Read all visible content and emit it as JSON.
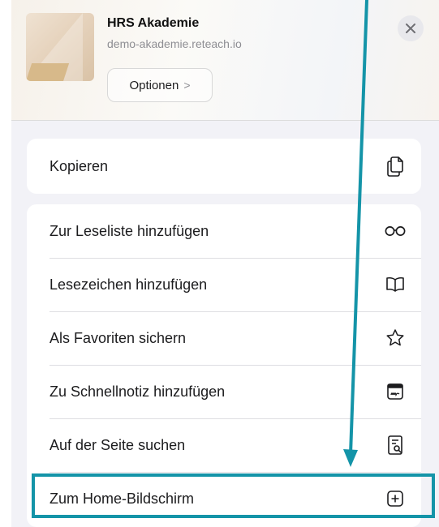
{
  "header": {
    "title": "HRS Akademie",
    "url": "demo-akademie.reteach.io",
    "options_label": "Optionen",
    "options_chevron": ">"
  },
  "menu": {
    "group1": [
      {
        "label": "Kopieren",
        "icon": "copy-icon"
      }
    ],
    "group2": [
      {
        "label": "Zur Leseliste hinzufügen",
        "icon": "glasses-icon"
      },
      {
        "label": "Lesezeichen hinzufügen",
        "icon": "book-icon"
      },
      {
        "label": "Als Favoriten sichern",
        "icon": "star-icon"
      },
      {
        "label": "Zu Schnellnotiz hinzufügen",
        "icon": "quick-note-icon"
      },
      {
        "label": "Auf der Seite suchen",
        "icon": "find-in-page-icon"
      },
      {
        "label": "Zum Home-Bildschirm",
        "icon": "add-square-icon"
      }
    ]
  },
  "colors": {
    "annotation": "#1494a8",
    "sheet_background": "#f2f2f7",
    "text": "#1c1c1e",
    "secondary_text": "#8e8e93"
  }
}
